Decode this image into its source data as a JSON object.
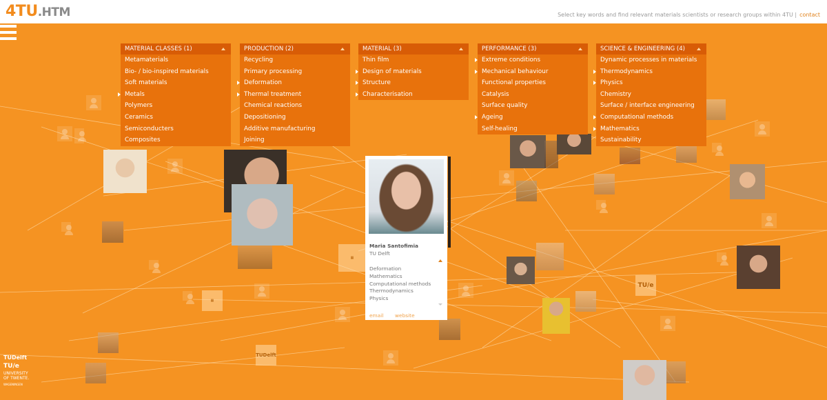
{
  "header": {
    "logo_primary": "4TU",
    "logo_secondary": ".HTM",
    "tagline": "Select key words and find relevant materials scientists or research groups within 4TU |",
    "contact_label": "contact"
  },
  "colors": {
    "background": "#f59322",
    "panel": "#e8720c",
    "panel_header": "#d85c06",
    "accent_link": "#e0811a"
  },
  "filters": [
    {
      "title": "MATERIAL CLASSES (1)",
      "items": [
        {
          "label": "Metamaterials",
          "selected": false
        },
        {
          "label": "Bio- / bio-inspired materials",
          "selected": false
        },
        {
          "label": "Soft materials",
          "selected": false
        },
        {
          "label": "Metals",
          "selected": true
        },
        {
          "label": "Polymers",
          "selected": false
        },
        {
          "label": "Ceramics",
          "selected": false
        },
        {
          "label": "Semiconducters",
          "selected": false
        },
        {
          "label": "Composites",
          "selected": false
        }
      ]
    },
    {
      "title": "PRODUCTION (2)",
      "items": [
        {
          "label": "Recycling",
          "selected": false
        },
        {
          "label": "Primary processing",
          "selected": false
        },
        {
          "label": "Deformation",
          "selected": true
        },
        {
          "label": "Thermal treatment",
          "selected": true
        },
        {
          "label": "Chemical reactions",
          "selected": false
        },
        {
          "label": "Depositioning",
          "selected": false
        },
        {
          "label": "Additive manufacturing",
          "selected": false
        },
        {
          "label": "Joining",
          "selected": false
        }
      ]
    },
    {
      "title": "MATERIAL (3)",
      "items": [
        {
          "label": "Thin film",
          "selected": false
        },
        {
          "label": "Design of materials",
          "selected": true
        },
        {
          "label": "Structure",
          "selected": true
        },
        {
          "label": "Characterisation",
          "selected": true
        }
      ]
    },
    {
      "title": "PERFORMANCE (3)",
      "items": [
        {
          "label": "Extreme conditions",
          "selected": true
        },
        {
          "label": "Mechanical behaviour",
          "selected": true
        },
        {
          "label": "Functional  properties",
          "selected": false
        },
        {
          "label": "Catalysis",
          "selected": false
        },
        {
          "label": "Surface quality",
          "selected": false
        },
        {
          "label": "Ageing",
          "selected": true
        },
        {
          "label": "Self-healing",
          "selected": false
        }
      ]
    },
    {
      "title": "SCIENCE & ENGINEERING (4)",
      "items": [
        {
          "label": "Dynamic processes in materials",
          "selected": false
        },
        {
          "label": "Thermodynamics",
          "selected": true
        },
        {
          "label": "Physics",
          "selected": true
        },
        {
          "label": "Chemistry",
          "selected": false
        },
        {
          "label": "Surface / interface engineering",
          "selected": false
        },
        {
          "label": "Computational methods",
          "selected": true
        },
        {
          "label": "Mathematics",
          "selected": true
        },
        {
          "label": "Sustainability",
          "selected": false
        }
      ]
    }
  ],
  "profile_card": {
    "name": "Maria Santofimia",
    "institution": "TU Delft",
    "keywords": [
      "Deformation",
      "Mathematics",
      "Computational methods",
      "Thermodynamics",
      "Physics"
    ],
    "email_label": "email",
    "website_label": "website"
  },
  "institution_tiles": {
    "tue": "TU/e",
    "tudelft": "TUDelft"
  },
  "footer_logos": {
    "tudelft": "TUDelft",
    "tue": "TU/e",
    "twente_1": "UNIVERSITY",
    "twente_2": "OF TWENTE.",
    "wageningen": "WAGENINGEN"
  }
}
